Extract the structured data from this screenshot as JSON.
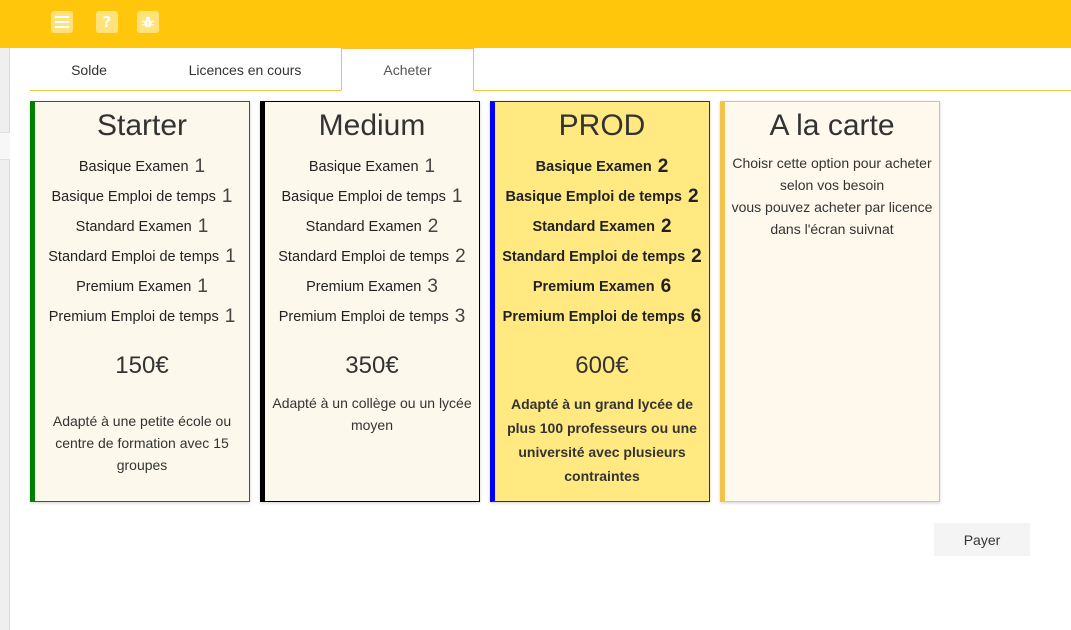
{
  "toolbar": {
    "menu_icon": "menu-icon",
    "help_label": "?",
    "bug_icon": "bug-icon"
  },
  "tabs": [
    {
      "label": "Solde"
    },
    {
      "label": "Licences en cours"
    },
    {
      "label": "Acheter",
      "active": true
    }
  ],
  "cards": [
    {
      "title": "Starter",
      "lines": [
        {
          "label": "Basique Examen",
          "qty": "1"
        },
        {
          "label": "Basique Emploi de temps",
          "qty": "1"
        },
        {
          "label": "Standard Examen",
          "qty": "1"
        },
        {
          "label": "Standard Emploi de temps",
          "qty": "1"
        },
        {
          "label": "Premium Examen",
          "qty": "1"
        },
        {
          "label": "Premium Emploi de temps",
          "qty": "1"
        }
      ],
      "price": "150€",
      "desc": "Adapté à une petite école ou centre de formation avec 15 groupes",
      "accent": "#008000"
    },
    {
      "title": "Medium",
      "lines": [
        {
          "label": "Basique Examen",
          "qty": "1"
        },
        {
          "label": "Basique Emploi de temps",
          "qty": "1"
        },
        {
          "label": "Standard Examen",
          "qty": "2"
        },
        {
          "label": "Standard Emploi de temps",
          "qty": "2"
        },
        {
          "label": "Premium Examen",
          "qty": "3"
        },
        {
          "label": "Premium Emploi de temps",
          "qty": "3"
        }
      ],
      "price": "350€",
      "desc": "Adapté à un collège ou un lycée moyen",
      "accent": "#000000"
    },
    {
      "title": "PROD",
      "lines": [
        {
          "label": "Basique Examen",
          "qty": "2"
        },
        {
          "label": "Basique Emploi de temps",
          "qty": "2"
        },
        {
          "label": "Standard Examen",
          "qty": "2"
        },
        {
          "label": "Standard Emploi de temps",
          "qty": "2"
        },
        {
          "label": "Premium Examen",
          "qty": "6"
        },
        {
          "label": "Premium Emploi de temps",
          "qty": "6"
        }
      ],
      "price": "600€",
      "desc": "Adapté à un grand lycée de plus 100 professeurs ou une université avec plusieurs contraintes",
      "accent": "#0000ff"
    },
    {
      "title": "A la carte",
      "desc_line1": "Choisr cette option pour acheter selon vos besoin",
      "desc_line2": "vous pouvez acheter par licence dans l'écran suivnat",
      "accent": "#f2c24a"
    }
  ],
  "pay_label": "Payer",
  "colors": {
    "topbar": "#ffc60c",
    "prod_bg": "#ffe980",
    "card_bg": "#fdf8ec"
  }
}
